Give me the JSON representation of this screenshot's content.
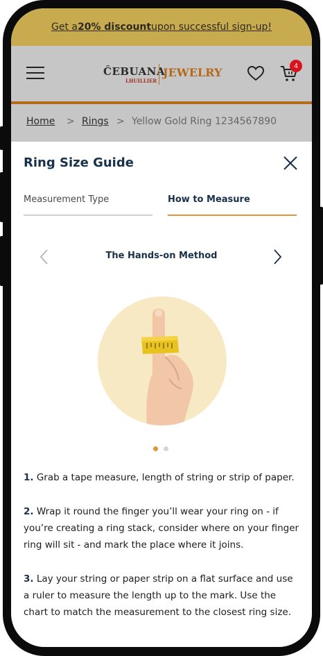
{
  "promo": {
    "prefix": "Get a ",
    "bold": "20% discount",
    "suffix": " upon successful sign-up!"
  },
  "header": {
    "logo_main": "ĈEBUANA",
    "logo_sub": "LHUILLIER",
    "logo_right": "JEWELRY",
    "cart_count": "4"
  },
  "breadcrumb": {
    "home": "Home",
    "rings": "Rings",
    "separator": ">",
    "current": "Yellow Gold Ring 1234567890"
  },
  "modal": {
    "title": "Ring Size Guide",
    "tabs": [
      {
        "label": "Measurement Type"
      },
      {
        "label": "How to Measure"
      }
    ],
    "method_title": "The Hands-on Method",
    "steps": [
      {
        "num": "1.",
        "text": " Grab a tape measure, length of string or strip of paper."
      },
      {
        "num": "2.",
        "text": " Wrap it round the finger you’ll wear your ring on - if you’re creating a ring stack, consider where on your finger ring will sit - and mark the place where it joins."
      },
      {
        "num": "3.",
        "text": " Lay your string or paper strip on a flat surface and use a ruler to measure the length up to the mark. Use the chart to match the measurement to the closest ring size."
      }
    ]
  },
  "colors": {
    "promo_bg": "#c9ab4f",
    "accent": "#e0953a",
    "brand_navy": "#18314a",
    "badge": "#d9141f"
  },
  "icons": [
    "hamburger-icon",
    "heart-icon",
    "cart-icon",
    "close-icon",
    "chevron-left-icon",
    "chevron-right-icon"
  ]
}
